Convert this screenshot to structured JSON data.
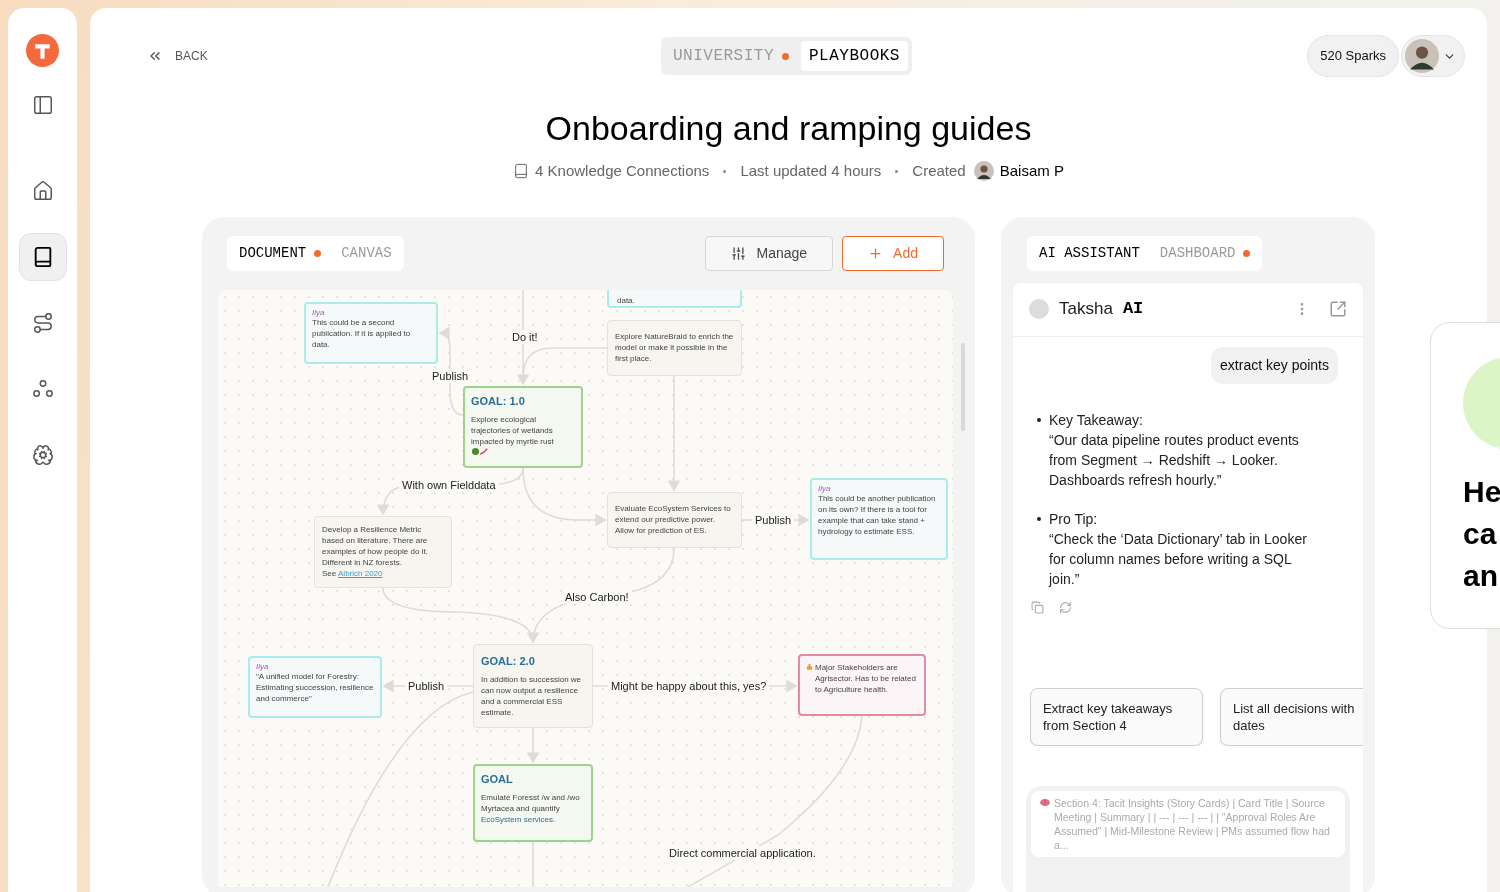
{
  "sidebar": {
    "items": [
      {
        "kind": "panel",
        "selected": false
      },
      {
        "kind": "home",
        "selected": false
      },
      {
        "kind": "book",
        "selected": true
      },
      {
        "kind": "route",
        "selected": false
      },
      {
        "kind": "nodes",
        "selected": false
      },
      {
        "kind": "brain",
        "selected": false
      }
    ]
  },
  "header": {
    "back": "BACK",
    "switch": [
      {
        "label": "UNIVERSITY",
        "dot": true,
        "selected": false
      },
      {
        "label": "PLAYBOOKS",
        "dot": false,
        "selected": true
      }
    ],
    "sparks": "520 Sparks"
  },
  "title": "Onboarding and ramping guides",
  "meta": {
    "connections": "4 Knowledge Connections",
    "updated": "Last updated 4 hours",
    "created_label": "Created",
    "author": "Baisam P"
  },
  "document_panel": {
    "tabs": [
      {
        "label": "DOCUMENT",
        "dot": true,
        "selected": true
      },
      {
        "label": "CANVAS",
        "dot": false,
        "selected": false
      }
    ],
    "buttons": [
      {
        "label": "Manage",
        "kind": "outline"
      },
      {
        "label": "Add",
        "kind": "accent"
      }
    ],
    "canvas": {
      "nodes": [
        {
          "kind": "cut",
          "text": "data."
        },
        {
          "kind": "note",
          "author": "Ilya",
          "text": "This could be a second publication. If it is applied to data."
        },
        {
          "kind": "task",
          "text": "Explore NatureBraid to enrich the model or make it possible in the first place."
        },
        {
          "kind": "goal",
          "title": "GOAL: 1.0",
          "text": "Explore ecological trajectories of wetlands impacted by myrtle rust",
          "emoji": true
        },
        {
          "kind": "task",
          "text": "Evaluate EcoSystem Services to extend our predictive power. Allow for prediction of ES."
        },
        {
          "kind": "note",
          "author": "Ilya",
          "text": "This could be another publication on its own? If there is a tool for example that can take stand + hydrology to estimate ESS."
        },
        {
          "kind": "task",
          "text": "Develop a Resilience Metric based on literature. There are examples of how people do it. Different in NZ forests.",
          "link_prefix": "See",
          "link": "Albrich 2020"
        },
        {
          "kind": "note",
          "author": "Ilya",
          "text": "\"A unified model for Forestry: Estimating succession, resilience and commerce\""
        },
        {
          "kind": "task",
          "title": "GOAL: 2.0",
          "text": "In addition to succession we can now output a resilience and a commercial ESS estimate."
        },
        {
          "kind": "alert",
          "text": "Major Stakeholders are Agrisector. Has to be related to Agriculture health."
        },
        {
          "kind": "goal",
          "title": "GOAL",
          "text": "Emulate Foresst /w and /wo Myrtacea and quantify",
          "link": "EcoSystem services",
          "text_after": "."
        }
      ],
      "edge_labels": [
        "Do it!",
        "Publish",
        "With own Fielddata",
        "Publish",
        "Also Carbon!",
        "Publish",
        "Might be happy about this, yes?",
        "Direct commercial application."
      ]
    }
  },
  "assistant_panel": {
    "tabs": [
      {
        "label": "AI ASSISTANT",
        "dot": false,
        "selected": true
      },
      {
        "label": "DASHBOARD",
        "dot": true,
        "selected": false
      }
    ],
    "chat": {
      "name": "Taksha",
      "name_suffix": "AI",
      "user_message": "extract key points",
      "answer": [
        {
          "heading": "Key Takeaway:",
          "text": "“Our data pipeline routes product events from Segment → Redshift → Looker. Dashboards refresh hourly.”"
        },
        {
          "heading": "Pro Tip:",
          "text": "“Check the ‘Data Dictionary’ tab in Looker for column names before writing a SQL join.”"
        }
      ],
      "suggestions": [
        "Extract key takeaways from Section 4",
        "List all decisions with dates"
      ],
      "context_quote": "Section 4: Tacit Insights (Story Cards) | Card Title | Source Meeting | Summary | | --- | --- | --- | | \"Approval Roles Are Assumed\" | Mid-Milestone Review | PMs assumed flow had a..."
    }
  },
  "side_card": {
    "lines": [
      "He",
      "ca",
      "an"
    ]
  }
}
